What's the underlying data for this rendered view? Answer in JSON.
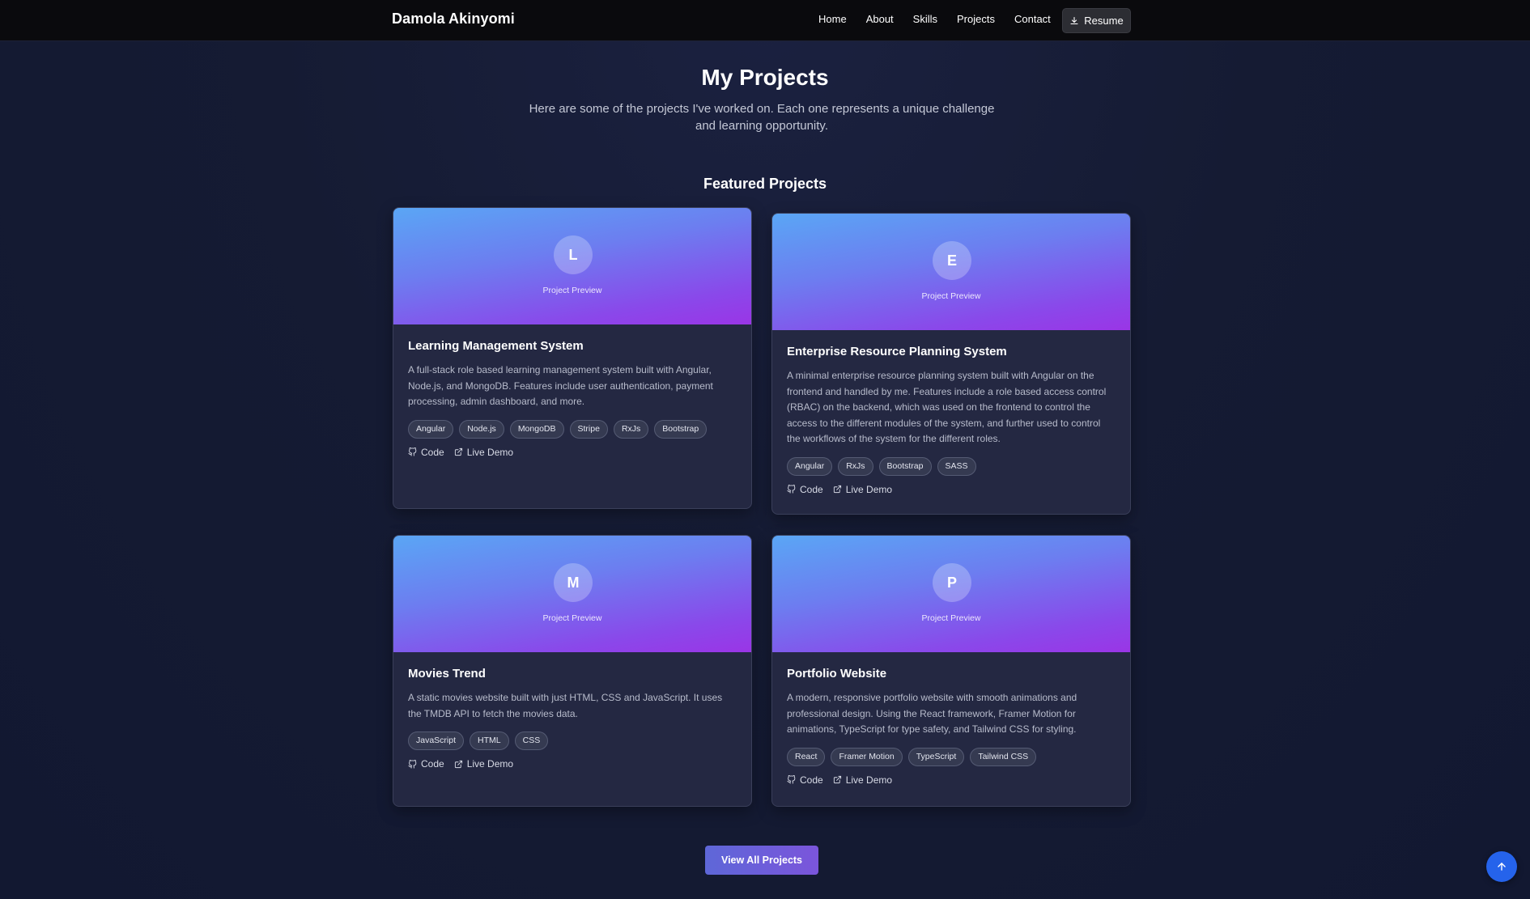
{
  "nav": {
    "brand": "Damola Akinyomi",
    "links": [
      "Home",
      "About",
      "Skills",
      "Projects",
      "Contact"
    ],
    "resume_label": "Resume"
  },
  "header": {
    "title": "My Projects",
    "subtitle": "Here are some of the projects I've worked on. Each one represents a unique challenge and learning opportunity."
  },
  "featured": {
    "title": "Featured Projects",
    "preview_label": "Project Preview",
    "code_label": "Code",
    "demo_label": "Live Demo",
    "projects": [
      {
        "initial": "L",
        "title": "Learning Management System",
        "description": "A full-stack role based learning management system built with Angular, Node.js, and MongoDB. Features include user authentication, payment processing, admin dashboard, and more.",
        "tags": [
          "Angular",
          "Node.js",
          "MongoDB",
          "Stripe",
          "RxJs",
          "Bootstrap"
        ]
      },
      {
        "initial": "E",
        "title": "Enterprise Resource Planning System",
        "description": "A minimal enterprise resource planning system built with Angular on the frontend and handled by me. Features include a role based access control (RBAC) on the backend, which was used on the frontend to control the access to the different modules of the system, and further used to control the workflows of the system for the different roles.",
        "tags": [
          "Angular",
          "RxJs",
          "Bootstrap",
          "SASS"
        ]
      },
      {
        "initial": "M",
        "title": "Movies Trend",
        "description": "A static movies website built with just HTML, CSS and JavaScript. It uses the TMDB API to fetch the movies data.",
        "tags": [
          "JavaScript",
          "HTML",
          "CSS"
        ]
      },
      {
        "initial": "P",
        "title": "Portfolio Website",
        "description": "A modern, responsive portfolio website with smooth animations and professional design. Using the React framework, Framer Motion for animations, TypeScript for type safety, and Tailwind CSS for styling.",
        "tags": [
          "React",
          "Framer Motion",
          "TypeScript",
          "Tailwind CSS"
        ]
      }
    ]
  },
  "view_all_label": "View All Projects",
  "icons": {
    "resume": "download-icon",
    "code": "github-icon",
    "demo": "external-link-icon",
    "scroll_top": "arrow-up-icon"
  },
  "colors": {
    "accent": "#2563eb",
    "navbar_bg": "#0a0a0d",
    "card_bg": "#242842",
    "preview_gradient_start": "#5aa6f5",
    "preview_gradient_end": "#9a35e6"
  }
}
